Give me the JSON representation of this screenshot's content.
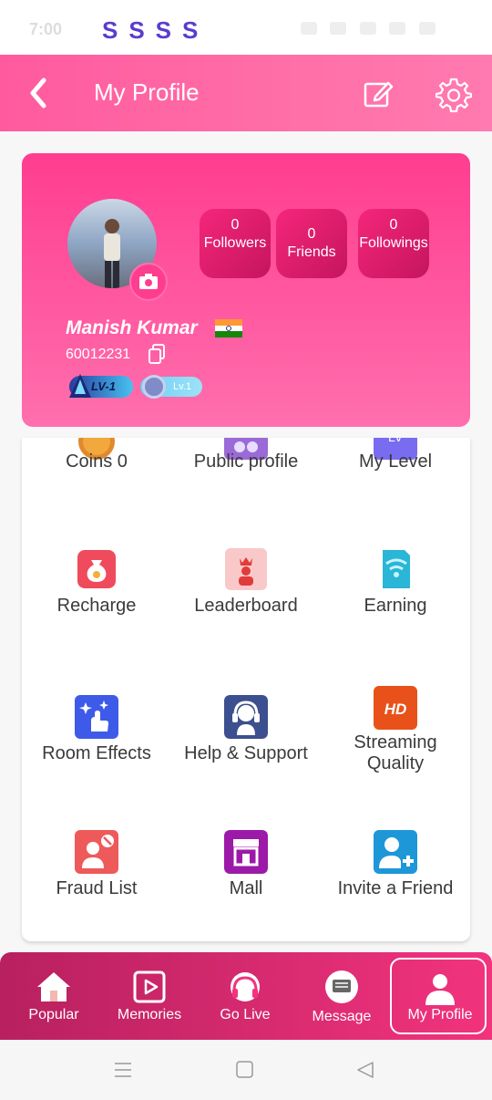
{
  "status_bar": {
    "time": "7:00",
    "marks": "SSSS"
  },
  "app_bar": {
    "title": "My Profile"
  },
  "profile": {
    "name": "Manish Kumar",
    "user_id": "60012231",
    "stats": [
      {
        "value": "0",
        "label": "Followers"
      },
      {
        "value": "0",
        "label": "Friends"
      },
      {
        "value": "0",
        "label": "Followings"
      }
    ],
    "badge_level": "LV-1",
    "badge_level_2": "Lv.1"
  },
  "menu": [
    {
      "label": "Coins 0",
      "icon": "coin-icon"
    },
    {
      "label": "Public profile",
      "icon": "glasses-icon"
    },
    {
      "label": "My Level",
      "icon": "level-icon"
    },
    {
      "label": "Recharge",
      "icon": "money-bag-icon"
    },
    {
      "label": "Leaderboard",
      "icon": "crown-user-icon"
    },
    {
      "label": "Earning",
      "icon": "earning-card-icon"
    },
    {
      "label": "Room Effects",
      "icon": "sparkle-icon"
    },
    {
      "label": "Help & Support",
      "icon": "headset-icon"
    },
    {
      "label": "Streaming Quality",
      "icon": "hd-icon"
    },
    {
      "label": "Fraud List",
      "icon": "blocked-user-icon"
    },
    {
      "label": "Mall",
      "icon": "store-icon"
    },
    {
      "label": "Invite a Friend",
      "icon": "add-user-icon"
    }
  ],
  "bottom_nav": [
    {
      "label": "Popular",
      "icon": "home-icon"
    },
    {
      "label": "Memories",
      "icon": "play-icon"
    },
    {
      "label": "Go Live",
      "icon": "live-icon"
    },
    {
      "label": "Message",
      "icon": "message-icon"
    },
    {
      "label": "My Profile",
      "icon": "person-icon",
      "active": true
    }
  ],
  "colors": {
    "brand_pink": "#ff3d8f",
    "nav_dark": "#b8205f",
    "text": "#3a3a3a"
  }
}
